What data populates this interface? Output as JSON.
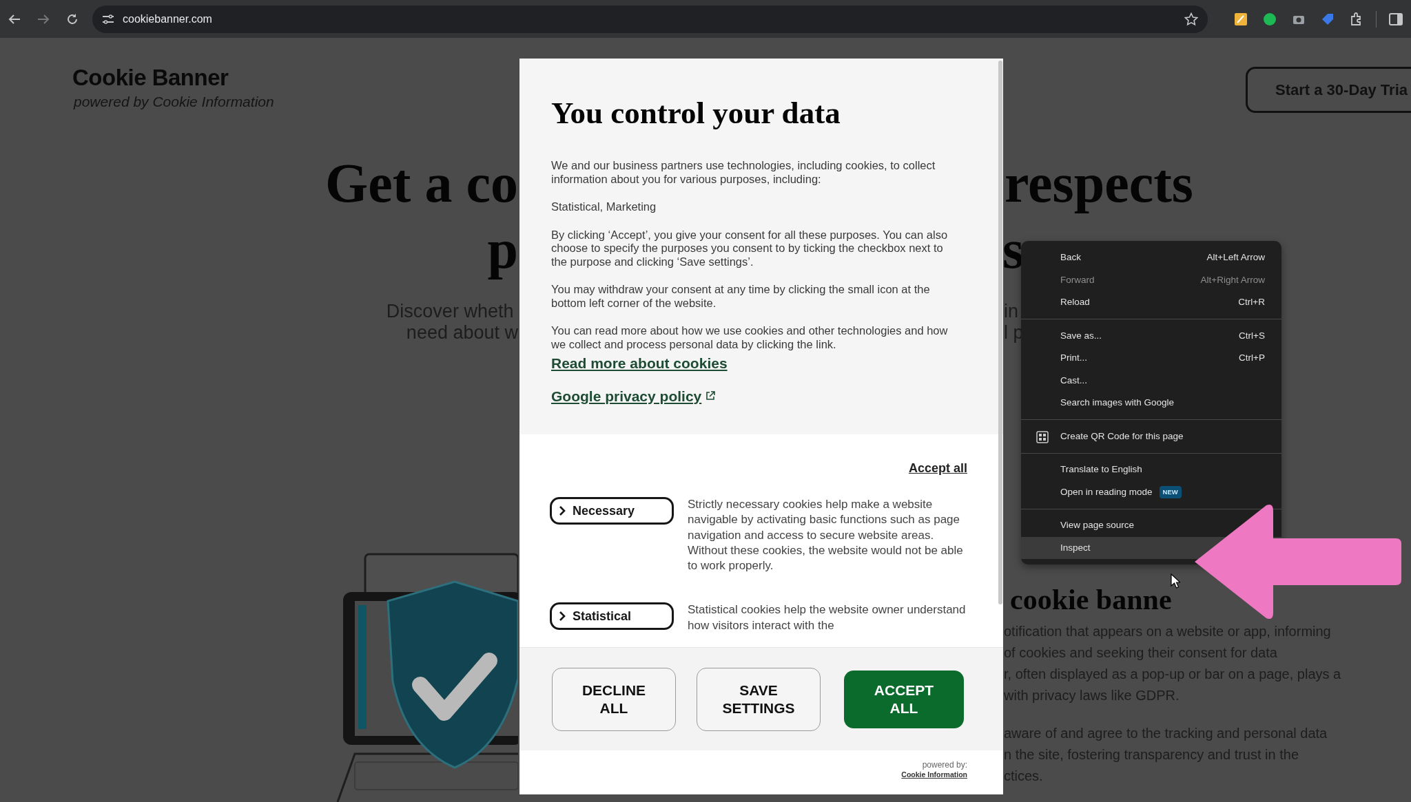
{
  "browser": {
    "url": "cookiebanner.com"
  },
  "page": {
    "logo_title": "Cookie Banner",
    "logo_subtitle": "powered by Cookie Information",
    "trial_button": "Start a 30-Day Tria",
    "headline_left": [
      "Get a co",
      "p"
    ],
    "headline_right": [
      "respects",
      "s"
    ],
    "intro_left": [
      "Discover wheth",
      "need about w"
    ],
    "intro_right": [
      "in",
      "l p"
    ],
    "section_heading": "cookie banne",
    "section_paragraphs": [
      [
        "otification that appears on a website or app, informing",
        "of cookies and seeking their consent for data",
        "r, often displayed as a pop-up or bar on a page, plays a",
        "with privacy laws like GDPR."
      ],
      [
        "aware of and agree to the tracking and personal data",
        "n the site, fostering transparency and trust in the",
        "ctices."
      ]
    ]
  },
  "modal": {
    "title": "You control your data",
    "paragraphs": [
      "We and our business partners use technologies, including cookies, to collect information about you for various purposes, including:",
      "Statistical, Marketing",
      "By clicking ‘Accept’, you give your consent for all these purposes. You can also choose to specify the purposes you consent to by ticking the checkbox next to the purpose and clicking ‘Save settings’.",
      "You may withdraw your consent at any time by clicking the small icon at the bottom left corner of the website.",
      "You can read more about how we use cookies and other technologies and how we collect and process personal data by clicking the link."
    ],
    "links": [
      {
        "text": "Read more about cookies",
        "external": false
      },
      {
        "text": "Google privacy policy",
        "external": true
      }
    ],
    "accept_all_link": "Accept all",
    "categories": [
      {
        "name": "Necessary",
        "expanded": false,
        "description": "Strictly necessary cookies help make a website navigable by activating basic functions such as page navigation and access to secure website areas. Without these cookies, the website would not be able to work properly."
      },
      {
        "name": "Statistical",
        "expanded": false,
        "description": "Statistical cookies help the website owner understand how visitors interact with the"
      }
    ],
    "buttons": [
      {
        "label": "DECLINE ALL",
        "kind": "secondary"
      },
      {
        "label": "SAVE SETTINGS",
        "kind": "secondary"
      },
      {
        "label": "ACCEPT ALL",
        "kind": "primary"
      }
    ],
    "powered_by": "powered by:",
    "powered_by_link": "Cookie Information"
  },
  "context_menu": {
    "items": [
      {
        "kind": "item",
        "label": "Back",
        "shortcut": "Alt+Left Arrow",
        "disabled": false,
        "selected": false
      },
      {
        "kind": "item",
        "label": "Forward",
        "shortcut": "Alt+Right Arrow",
        "disabled": true,
        "selected": false
      },
      {
        "kind": "item",
        "label": "Reload",
        "shortcut": "Ctrl+R",
        "disabled": false,
        "selected": false
      },
      {
        "kind": "separator"
      },
      {
        "kind": "item",
        "label": "Save as...",
        "shortcut": "Ctrl+S",
        "disabled": false,
        "selected": false
      },
      {
        "kind": "item",
        "label": "Print...",
        "shortcut": "Ctrl+P",
        "disabled": false,
        "selected": false
      },
      {
        "kind": "item",
        "label": "Cast...",
        "disabled": false,
        "selected": false
      },
      {
        "kind": "item",
        "label": "Search images with Google",
        "disabled": false,
        "selected": false
      },
      {
        "kind": "separator"
      },
      {
        "kind": "icon-item",
        "label": "Create QR Code for this page",
        "disabled": false,
        "selected": false
      },
      {
        "kind": "separator"
      },
      {
        "kind": "item",
        "label": "Translate to English",
        "disabled": false,
        "selected": false
      },
      {
        "kind": "item",
        "label": "Open in reading mode",
        "badge": "NEW",
        "disabled": false,
        "selected": false
      },
      {
        "kind": "separator"
      },
      {
        "kind": "item",
        "label": "View page source",
        "disabled": false,
        "selected": false
      },
      {
        "kind": "item",
        "label": "Inspect",
        "disabled": false,
        "selected": true
      }
    ]
  }
}
